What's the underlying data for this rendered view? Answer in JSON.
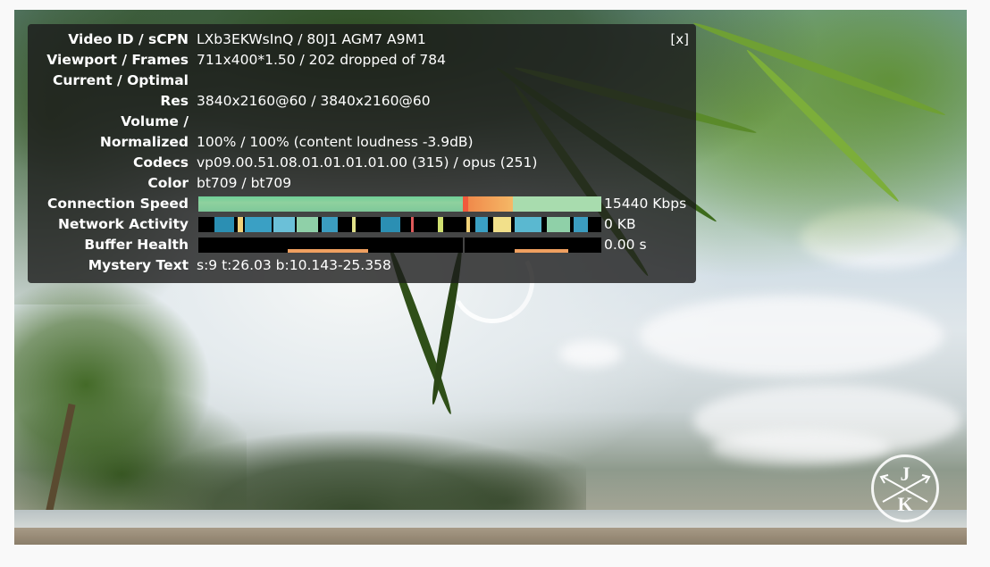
{
  "stats": {
    "close_label": "[x]",
    "rows": [
      {
        "label": "Video ID / sCPN",
        "value": "LXb3EKWsInQ / 80J1 AGM7 A9M1"
      },
      {
        "label": "Viewport / Frames",
        "value": "711x400*1.50 / 202 dropped of 784"
      },
      {
        "label": "Current / Optimal",
        "value": ""
      },
      {
        "label": "Res",
        "value": "3840x2160@60 / 3840x2160@60"
      },
      {
        "label": "Volume /",
        "value": ""
      },
      {
        "label": "Normalized",
        "value": "100% / 100% (content loudness -3.9dB)"
      },
      {
        "label": "Codecs",
        "value": "vp09.00.51.08.01.01.01.01.00 (315) / opus (251)"
      },
      {
        "label": "Color",
        "value": "bt709 / bt709"
      },
      {
        "label": "Connection Speed",
        "value": "15440 Kbps"
      },
      {
        "label": "Network Activity",
        "value": "0 KB"
      },
      {
        "label": "Buffer Health",
        "value": "0.00 s"
      },
      {
        "label": "Mystery Text",
        "value": "s:9 t:26.03 b:10.143-25.358"
      }
    ]
  },
  "watermark": {
    "top_letter": "J",
    "bottom_letter": "K"
  },
  "colors": {
    "panel_bg": "#1c1c1c",
    "speed_green": "#8fd19e",
    "speed_orange": "#f08a4b",
    "buffer_orange": "#f0a060"
  }
}
